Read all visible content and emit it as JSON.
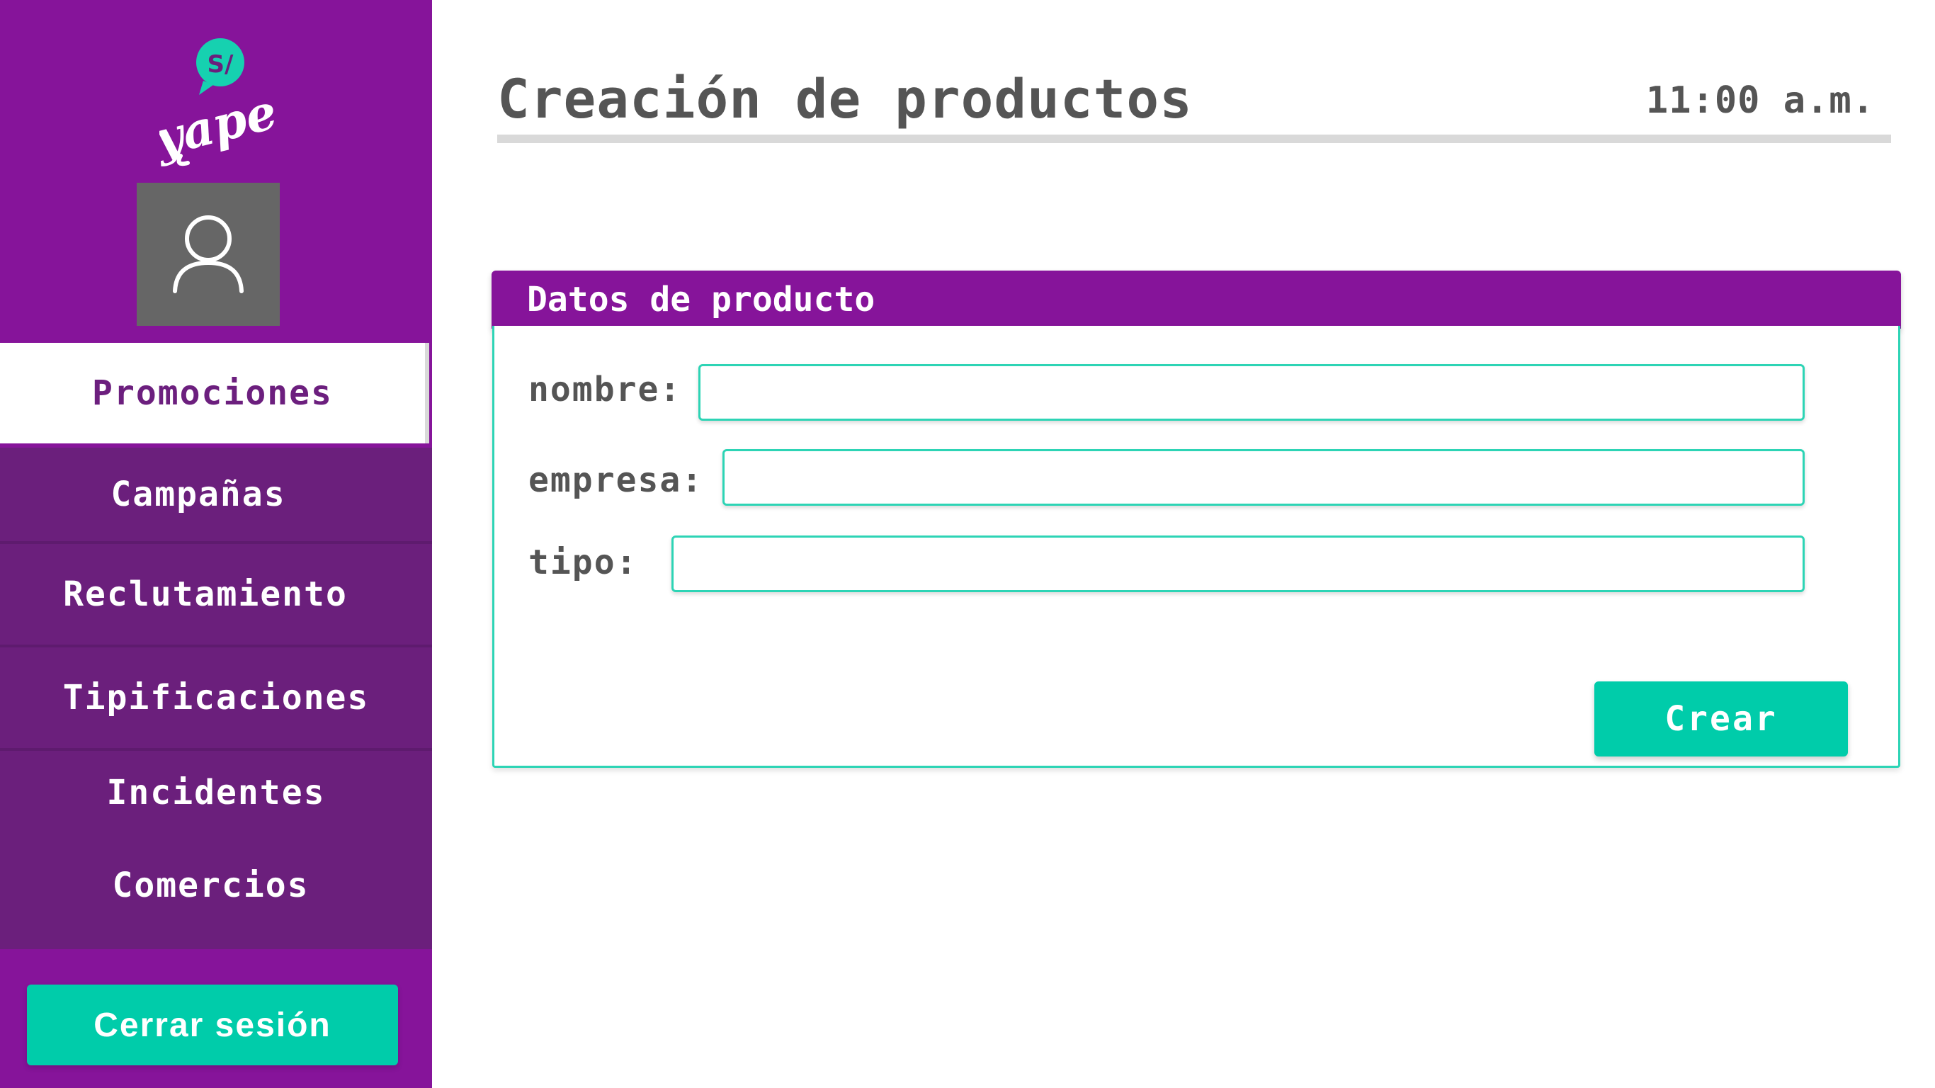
{
  "brand": {
    "logo_symbol": "S/",
    "logo_text": "yape",
    "colors": {
      "primary": "#86149a",
      "accent": "#00ccaa",
      "nav_item": "#6b1f7c"
    }
  },
  "user": {
    "avatar_icon": "user-icon"
  },
  "sidebar": {
    "items": [
      {
        "label": "Promociones",
        "active": true
      },
      {
        "label": "Campañas",
        "active": false
      },
      {
        "label": "Reclutamiento",
        "active": false
      },
      {
        "label": "Tipificaciones",
        "active": false
      },
      {
        "label": "Incidentes",
        "active": false
      },
      {
        "label": "Comercios",
        "active": false
      }
    ],
    "logout_label": "Cerrar sesión"
  },
  "header": {
    "title": "Creación de productos",
    "time": "11:00 a.m."
  },
  "form": {
    "title": "Datos de producto",
    "fields": [
      {
        "label": "nombre:",
        "value": ""
      },
      {
        "label": "empresa:",
        "value": ""
      },
      {
        "label": "tipo:",
        "value": ""
      }
    ],
    "submit_label": "Crear"
  }
}
